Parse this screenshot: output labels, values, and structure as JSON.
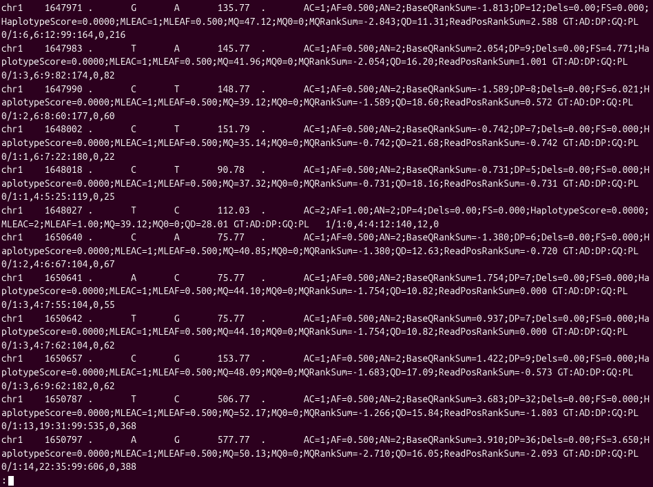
{
  "records": [
    {
      "chrom": "chr1",
      "pos": "1647971",
      "id": ".",
      "ref": "G",
      "alt": "A",
      "qual": "135.77",
      "filter": ".",
      "info": "AC=1;AF=0.500;AN=2;BaseQRankSum=-1.813;DP=12;Dels=0.00;FS=0.000;HaplotypeScore=0.0000;MLEAC=1;MLEAF=0.500;MQ=47.12;MQ0=0;MQRankSum=-2.843;QD=11.31;ReadPosRankSum=2.588",
      "format": "GT:AD:DP:GQ:PL",
      "sample": "0/1:6,6:12:99:164,0,216"
    },
    {
      "chrom": "chr1",
      "pos": "1647983",
      "id": ".",
      "ref": "T",
      "alt": "A",
      "qual": "145.77",
      "filter": ".",
      "info": "AC=1;AF=0.500;AN=2;BaseQRankSum=2.054;DP=9;Dels=0.00;FS=4.771;HaplotypeScore=0.0000;MLEAC=1;MLEAF=0.500;MQ=41.96;MQ0=0;MQRankSum=-2.054;QD=16.20;ReadPosRankSum=1.001",
      "format": "GT:AD:DP:GQ:PL",
      "sample": "0/1:3,6:9:82:174,0,82"
    },
    {
      "chrom": "chr1",
      "pos": "1647990",
      "id": ".",
      "ref": "C",
      "alt": "T",
      "qual": "148.77",
      "filter": ".",
      "info": "AC=1;AF=0.500;AN=2;BaseQRankSum=-1.589;DP=8;Dels=0.00;FS=6.021;HaplotypeScore=0.0000;MLEAC=1;MLEAF=0.500;MQ=39.12;MQ0=0;MQRankSum=-1.589;QD=18.60;ReadPosRankSum=0.572",
      "format": "GT:AD:DP:GQ:PL",
      "sample": "0/1:2,6:8:60:177,0,60"
    },
    {
      "chrom": "chr1",
      "pos": "1648002",
      "id": ".",
      "ref": "C",
      "alt": "T",
      "qual": "151.79",
      "filter": ".",
      "info": "AC=1;AF=0.500;AN=2;BaseQRankSum=-0.742;DP=7;Dels=0.00;FS=0.000;HaplotypeScore=0.0000;MLEAC=1;MLEAF=0.500;MQ=35.14;MQ0=0;MQRankSum=-0.742;QD=21.68;ReadPosRankSum=-0.742",
      "format": "GT:AD:DP:GQ:PL",
      "sample": "0/1:1,6:7:22:180,0,22"
    },
    {
      "chrom": "chr1",
      "pos": "1648018",
      "id": ".",
      "ref": "C",
      "alt": "T",
      "qual": "90.78",
      "filter": ".",
      "info": "AC=1;AF=0.500;AN=2;BaseQRankSum=-0.731;DP=5;Dels=0.00;FS=0.000;HaplotypeScore=0.0000;MLEAC=1;MLEAF=0.500;MQ=37.32;MQ0=0;MQRankSum=-0.731;QD=18.16;ReadPosRankSum=-0.731",
      "format": "GT:AD:DP:GQ:PL",
      "sample": "0/1:1,4:5:25:119,0,25"
    },
    {
      "chrom": "chr1",
      "pos": "1648027",
      "id": ".",
      "ref": "T",
      "alt": "C",
      "qual": "112.03",
      "filter": ".",
      "info": "AC=2;AF=1.00;AN=2;DP=4;Dels=0.00;FS=0.000;HaplotypeScore=0.0000;MLEAC=2;MLEAF=1.00;MQ=39.12;MQ0=0;QD=28.01",
      "format": "GT:AD:DP:GQ:PL",
      "sample": "1/1:0,4:4:12:140,12,0"
    },
    {
      "chrom": "chr1",
      "pos": "1650640",
      "id": ".",
      "ref": "C",
      "alt": "A",
      "qual": "75.77",
      "filter": ".",
      "info": "AC=1;AF=0.500;AN=2;BaseQRankSum=-1.380;DP=6;Dels=0.00;FS=0.000;HaplotypeScore=0.0000;MLEAC=1;MLEAF=0.500;MQ=40.85;MQ0=0;MQRankSum=-1.380;QD=12.63;ReadPosRankSum=-0.720",
      "format": "GT:AD:DP:GQ:PL",
      "sample": "0/1:2,4:6:67:104,0,67"
    },
    {
      "chrom": "chr1",
      "pos": "1650641",
      "id": ".",
      "ref": "A",
      "alt": "C",
      "qual": "75.77",
      "filter": ".",
      "info": "AC=1;AF=0.500;AN=2;BaseQRankSum=1.754;DP=7;Dels=0.00;FS=0.000;HaplotypeScore=0.0000;MLEAC=1;MLEAF=0.500;MQ=44.10;MQ0=0;MQRankSum=-1.754;QD=10.82;ReadPosRankSum=0.000",
      "format": "GT:AD:DP:GQ:PL",
      "sample": "0/1:3,4:7:55:104,0,55"
    },
    {
      "chrom": "chr1",
      "pos": "1650642",
      "id": ".",
      "ref": "T",
      "alt": "G",
      "qual": "75.77",
      "filter": ".",
      "info": "AC=1;AF=0.500;AN=2;BaseQRankSum=0.937;DP=7;Dels=0.00;FS=0.000;HaplotypeScore=0.0000;MLEAC=1;MLEAF=0.500;MQ=44.10;MQ0=0;MQRankSum=-1.754;QD=10.82;ReadPosRankSum=0.000",
      "format": "GT:AD:DP:GQ:PL",
      "sample": "0/1:3,4:7:62:104,0,62"
    },
    {
      "chrom": "chr1",
      "pos": "1650657",
      "id": ".",
      "ref": "C",
      "alt": "G",
      "qual": "153.77",
      "filter": ".",
      "info": "AC=1;AF=0.500;AN=2;BaseQRankSum=1.422;DP=9;Dels=0.00;FS=0.000;HaplotypeScore=0.0000;MLEAC=1;MLEAF=0.500;MQ=48.09;MQ0=0;MQRankSum=-1.683;QD=17.09;ReadPosRankSum=-0.573",
      "format": "GT:AD:DP:GQ:PL",
      "sample": "0/1:3,6:9:62:182,0,62"
    },
    {
      "chrom": "chr1",
      "pos": "1650787",
      "id": ".",
      "ref": "T",
      "alt": "C",
      "qual": "506.77",
      "filter": ".",
      "info": "AC=1;AF=0.500;AN=2;BaseQRankSum=3.683;DP=32;Dels=0.00;FS=0.000;HaplotypeScore=0.0000;MLEAC=1;MLEAF=0.500;MQ=52.17;MQ0=0;MQRankSum=-1.266;QD=15.84;ReadPosRankSum=-1.803",
      "format": "GT:AD:DP:GQ:PL",
      "sample": "0/1:13,19:31:99:535,0,368"
    },
    {
      "chrom": "chr1",
      "pos": "1650797",
      "id": ".",
      "ref": "A",
      "alt": "G",
      "qual": "577.77",
      "filter": ".",
      "info": "AC=1;AF=0.500;AN=2;BaseQRankSum=3.910;DP=36;Dels=0.00;FS=3.650;HaplotypeScore=0.0000;MLEAC=1;MLEAF=0.500;MQ=50.13;MQ0=0;MQRankSum=-2.710;QD=16.05;ReadPosRankSum=-2.093",
      "format": "GT:AD:DP:GQ:PL",
      "sample": "0/1:14,22:35:99:606,0,388"
    }
  ],
  "prompt": ":"
}
